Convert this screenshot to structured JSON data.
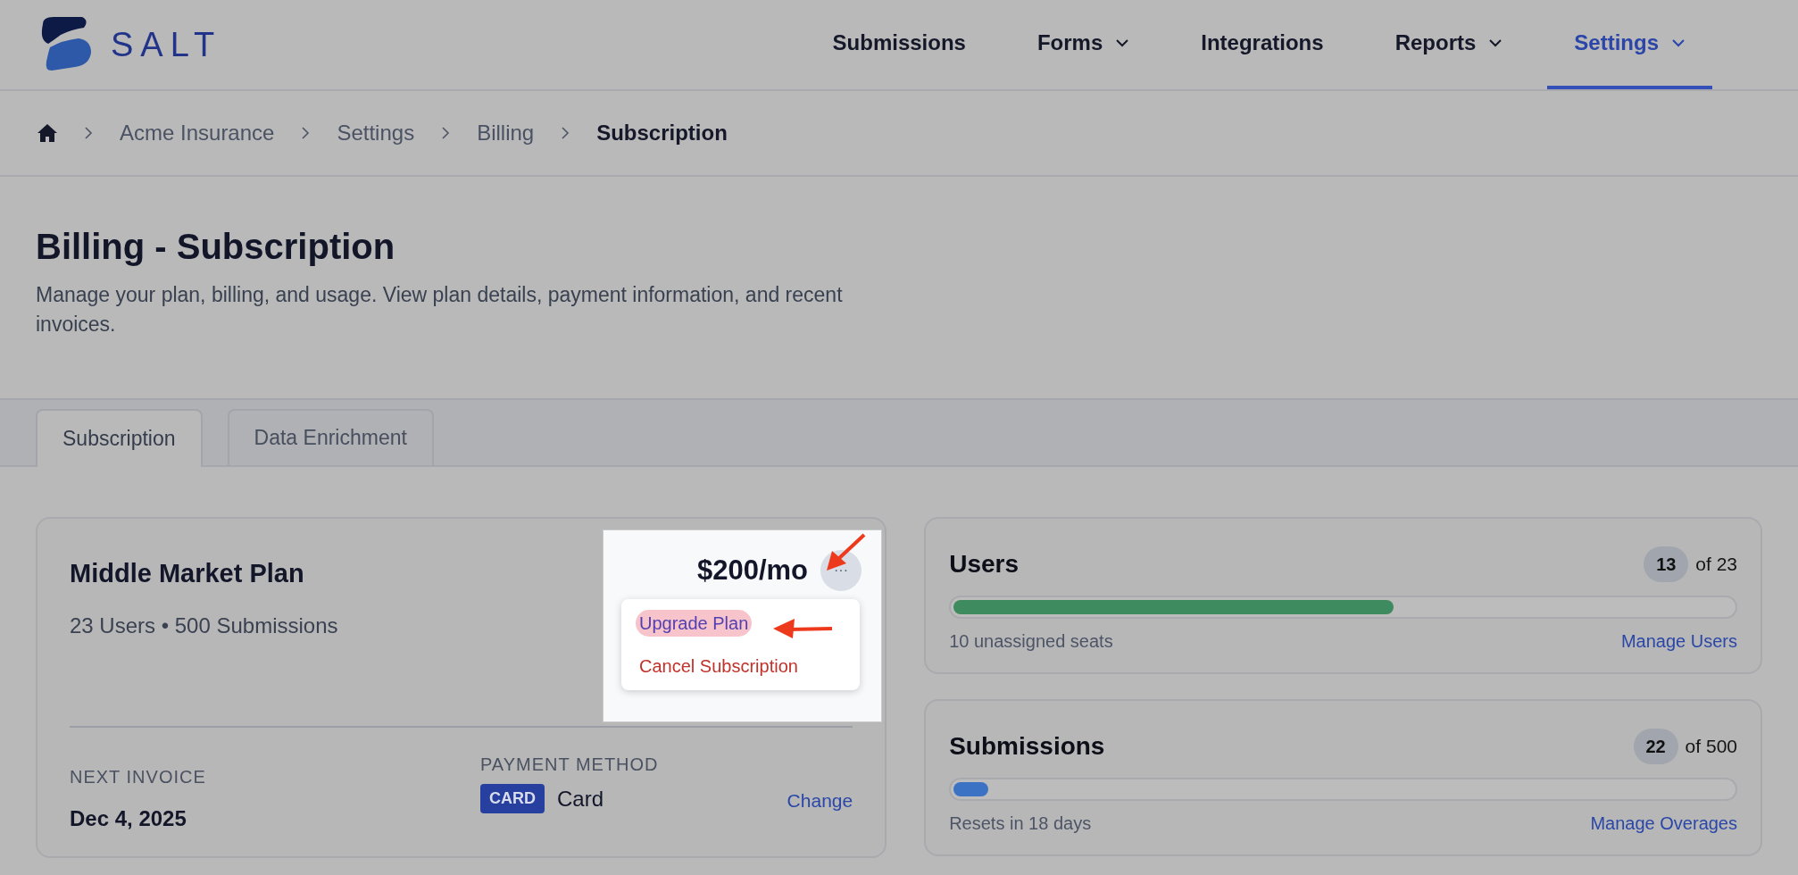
{
  "brand": {
    "name": "SALT"
  },
  "nav": [
    {
      "label": "Submissions",
      "dropdown": false,
      "selected": false
    },
    {
      "label": "Forms",
      "dropdown": true,
      "selected": false
    },
    {
      "label": "Integrations",
      "dropdown": false,
      "selected": false
    },
    {
      "label": "Reports",
      "dropdown": true,
      "selected": false
    },
    {
      "label": "Settings",
      "dropdown": true,
      "selected": true
    }
  ],
  "breadcrumb": [
    "Acme Insurance",
    "Settings",
    "Billing",
    "Subscription"
  ],
  "page": {
    "title": "Billing - Subscription",
    "description": "Manage your plan, billing, and usage. View plan details, payment information, and recent invoices."
  },
  "tabs": [
    {
      "label": "Subscription",
      "selected": true
    },
    {
      "label": "Data Enrichment",
      "selected": false
    }
  ],
  "plan": {
    "name": "Middle Market Plan",
    "summary": "23 Users • 500 Submissions",
    "price": "$200/mo",
    "more_button": "···",
    "menu": [
      {
        "label": "Upgrade Plan",
        "kind": "primary",
        "highlighted": true
      },
      {
        "label": "Cancel Subscription",
        "kind": "danger",
        "highlighted": false
      }
    ],
    "next_invoice": {
      "label": "NEXT INVOICE",
      "value": "Dec 4, 2025"
    },
    "payment_method": {
      "label": "PAYMENT METHOD",
      "badge": "CARD",
      "value": "Card",
      "action": "Change"
    }
  },
  "usage": [
    {
      "title": "Users",
      "count": "13",
      "total": "of 23",
      "level": 0.565,
      "color": "#3f8b60",
      "note": "10 unassigned seats",
      "action": "Manage Users"
    },
    {
      "title": "Submissions",
      "count": "22",
      "total": "of 500",
      "level": 0.044,
      "color": "#3b72c4",
      "note": "Resets in 18 days",
      "action": "Manage Overages"
    }
  ]
}
